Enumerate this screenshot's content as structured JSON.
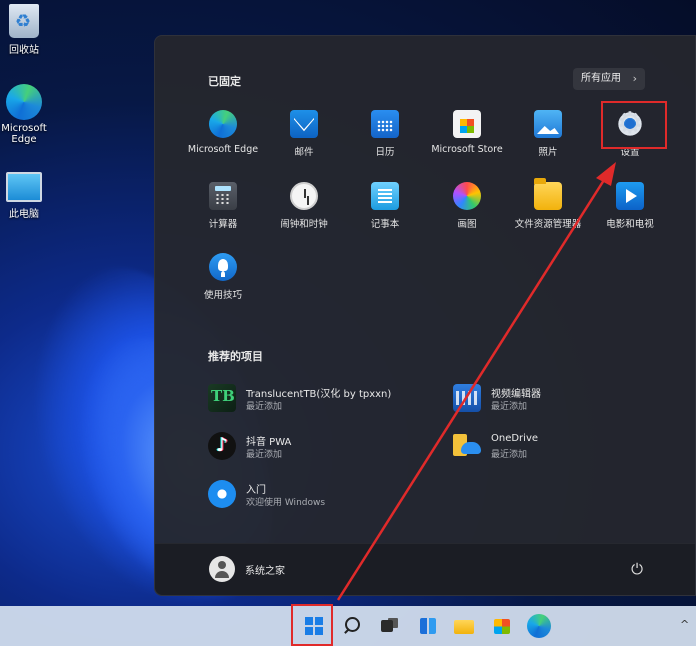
{
  "desktop": {
    "icons": [
      {
        "label": "回收站",
        "icon": "recycle-bin-icon"
      },
      {
        "label": "Microsoft Edge",
        "icon": "edge-icon"
      },
      {
        "label": "此电脑",
        "icon": "this-pc-icon"
      }
    ]
  },
  "start_menu": {
    "pinned_title": "已固定",
    "all_apps_label": "所有应用",
    "all_apps_chevron": "›",
    "pinned": [
      {
        "label": "Microsoft Edge",
        "icon": "edge-icon"
      },
      {
        "label": "邮件",
        "icon": "mail-icon"
      },
      {
        "label": "日历",
        "icon": "calendar-icon"
      },
      {
        "label": "Microsoft Store",
        "icon": "store-icon"
      },
      {
        "label": "照片",
        "icon": "photos-icon"
      },
      {
        "label": "设置",
        "icon": "settings-icon"
      },
      {
        "label": "计算器",
        "icon": "calculator-icon"
      },
      {
        "label": "闹钟和时钟",
        "icon": "alarm-clock-icon"
      },
      {
        "label": "记事本",
        "icon": "notepad-icon"
      },
      {
        "label": "画图",
        "icon": "paint-icon"
      },
      {
        "label": "文件资源管理器",
        "icon": "file-explorer-icon"
      },
      {
        "label": "电影和电视",
        "icon": "movies-tv-icon"
      },
      {
        "label": "使用技巧",
        "icon": "tips-icon"
      }
    ],
    "recommended_title": "推荐的项目",
    "recommended": [
      {
        "name": "TranslucentTB(汉化 by tpxxn)",
        "sub": "最近添加",
        "icon": "translucenttb-icon"
      },
      {
        "name": "视频编辑器",
        "sub": "最近添加",
        "icon": "video-editor-icon"
      },
      {
        "name": "抖音 PWA",
        "sub": "最近添加",
        "icon": "tiktok-icon"
      },
      {
        "name": "OneDrive",
        "sub": "最近添加",
        "icon": "onedrive-icon"
      },
      {
        "name": "入门",
        "sub": "欢迎使用 Windows",
        "icon": "get-started-icon"
      }
    ],
    "user_name": "系统之家",
    "power_glyph": "⏻"
  },
  "taskbar": {
    "items": [
      "start-icon",
      "search-icon",
      "task-view-icon",
      "widgets-icon",
      "file-explorer-icon",
      "store-icon",
      "edge-icon"
    ],
    "overflow_glyph": "^"
  },
  "colors": {
    "highlight": "#e02a2a",
    "accent": "#1a7de6"
  }
}
